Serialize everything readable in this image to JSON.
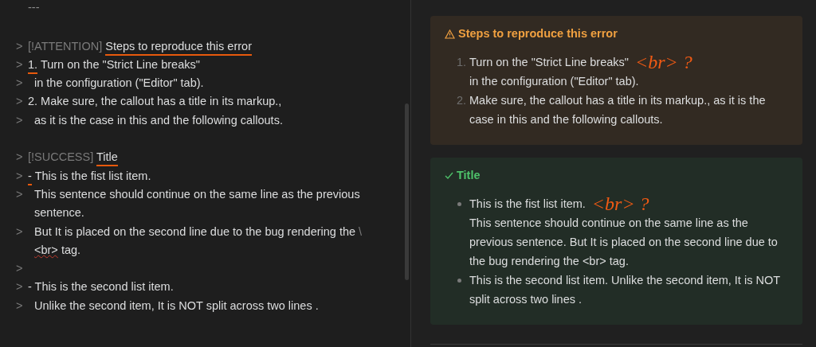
{
  "editor": {
    "rule": "---",
    "lines": [
      {
        "kind": "blank"
      },
      {
        "kind": "line",
        "prefix": ">",
        "segments": [
          {
            "text": "[!ATTENTION]",
            "kind": "meta"
          },
          {
            "text": "Steps to reproduce this error",
            "kind": "text",
            "underlined": true
          }
        ]
      },
      {
        "kind": "line",
        "prefix": ">",
        "segments": [
          {
            "text": "1.",
            "kind": "text",
            "underlined": true
          },
          {
            "text": "Turn on the \"Strict Line breaks\"",
            "kind": "text"
          }
        ]
      },
      {
        "kind": "continuation",
        "prefix": ">",
        "segments": [
          {
            "text": "in the configuration (\"Editor\" tab).",
            "kind": "text"
          }
        ]
      },
      {
        "kind": "line",
        "prefix": ">",
        "segments": [
          {
            "text": "2. Make sure, the callout has a title in its markup.,",
            "kind": "text"
          }
        ]
      },
      {
        "kind": "continuation",
        "prefix": ">",
        "segments": [
          {
            "text": "as it is the case in this and the following callouts.",
            "kind": "text"
          }
        ]
      },
      {
        "kind": "blank"
      },
      {
        "kind": "line",
        "prefix": ">",
        "segments": [
          {
            "text": "[!SUCCESS]",
            "kind": "meta"
          },
          {
            "text": "Title",
            "kind": "text",
            "underlined": true
          }
        ]
      },
      {
        "kind": "line",
        "prefix": ">",
        "segments": [
          {
            "text": "-",
            "kind": "text",
            "underlined": true
          },
          {
            "text": "This is the fist list item.",
            "kind": "text"
          }
        ]
      },
      {
        "kind": "continuation",
        "prefix": ">",
        "segments": [
          {
            "text": "This sentence should continue on the same line as the previous sentence.",
            "kind": "text"
          }
        ]
      },
      {
        "kind": "continuation",
        "prefix": ">",
        "segments": [
          {
            "text": "But It is placed on the second line due to the bug rendering the",
            "kind": "text"
          },
          {
            "text": "\\",
            "kind": "meta"
          },
          {
            "text": "<br>",
            "kind": "text",
            "misspelled": true
          },
          {
            "text": "tag.",
            "kind": "text"
          }
        ]
      },
      {
        "kind": "line",
        "prefix": ">"
      },
      {
        "kind": "line",
        "prefix": ">",
        "segments": [
          {
            "text": "- This is the second list item.",
            "kind": "text"
          }
        ]
      },
      {
        "kind": "continuation",
        "prefix": ">",
        "segments": [
          {
            "text": "Unlike the second item, It is NOT split across two lines .",
            "kind": "text"
          }
        ]
      }
    ]
  },
  "preview": {
    "callouts": [
      {
        "kind": "attention",
        "title": "Steps to reproduce this error",
        "items": [
          {
            "marker": "1.",
            "lines": [
              "Turn on the \"Strict Line breaks\"",
              "in the configuration (\"Editor\" tab)."
            ],
            "note": "<br> ?"
          },
          {
            "marker": "2.",
            "lines": [
              "Make sure, the callout has a title in its markup., as it is the case in this and the following callouts."
            ]
          }
        ]
      },
      {
        "kind": "success",
        "title": "Title",
        "items": [
          {
            "lines": [
              "This is the fist list item.",
              "This sentence should continue on the same line as the previous sentence. But It is placed on the second line due to the bug rendering the <br> tag."
            ],
            "note": "<br> ?"
          },
          {
            "lines": [
              "This is the second list item. Unlike the second item, It is NOT split across two lines ."
            ]
          }
        ]
      }
    ]
  }
}
